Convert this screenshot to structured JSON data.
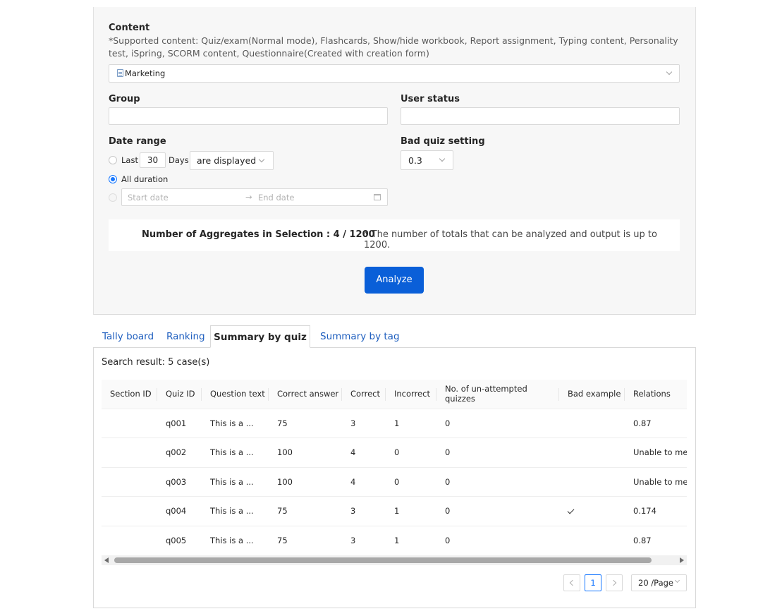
{
  "form": {
    "content_label": "Content",
    "content_note": "*Supported content: Quiz/exam(Normal mode), Flashcards, Show/hide workbook, Report assignment, Typing content, Personality test, iSpring, SCORM content, Questionnaire(Created with creation form)",
    "content_value": "Marketing",
    "group_label": "Group",
    "group_value": "",
    "user_status_label": "User status",
    "user_status_value": "",
    "date_range_label": "Date range",
    "last_label": "Last",
    "last_days": "30",
    "days_label": "Days",
    "display_select": "are displayed",
    "all_duration_label": "All duration",
    "selected_range_option": "all_duration",
    "start_placeholder": "Start date",
    "end_placeholder": "End date",
    "bad_quiz_label": "Bad quiz setting",
    "bad_quiz_value": "0.3"
  },
  "aggregates": {
    "label": "Number of Aggregates in Selection : 4 / 1200",
    "hint": "* The number of totals that can be analyzed and output is up to 1200."
  },
  "analyze_button": "Analyze",
  "tabs": [
    {
      "label": "Tally board",
      "active": false
    },
    {
      "label": "Ranking",
      "active": false
    },
    {
      "label": "Summary by quiz",
      "active": true
    },
    {
      "label": "Summary by tag",
      "active": false
    }
  ],
  "search_result": "Search result: 5 case(s)",
  "table": {
    "headers": [
      "Section ID",
      "Quiz ID",
      "Question text",
      "Correct answer",
      "Correct",
      "Incorrect",
      "No. of un-attempted quizzes",
      "Bad example",
      "Relations"
    ],
    "rows": [
      {
        "section_id": "",
        "quiz_id": "q001",
        "question": "This is a ...",
        "answer": "75",
        "correct": "3",
        "incorrect": "1",
        "unattempted": "0",
        "bad": false,
        "relations": "0.87"
      },
      {
        "section_id": "",
        "quiz_id": "q002",
        "question": "This is a ...",
        "answer": "100",
        "correct": "4",
        "incorrect": "0",
        "unattempted": "0",
        "bad": false,
        "relations": "Unable to measure"
      },
      {
        "section_id": "",
        "quiz_id": "q003",
        "question": "This is a ...",
        "answer": "100",
        "correct": "4",
        "incorrect": "0",
        "unattempted": "0",
        "bad": false,
        "relations": "Unable to measure"
      },
      {
        "section_id": "",
        "quiz_id": "q004",
        "question": "This is a ...",
        "answer": "75",
        "correct": "3",
        "incorrect": "1",
        "unattempted": "0",
        "bad": true,
        "relations": "0.174"
      },
      {
        "section_id": "",
        "quiz_id": "q005",
        "question": "This is a ...",
        "answer": "75",
        "correct": "3",
        "incorrect": "1",
        "unattempted": "0",
        "bad": false,
        "relations": "0.87"
      }
    ]
  },
  "pagination": {
    "current_page": "1",
    "page_size": "20 /Page"
  },
  "colors": {
    "accent": "#1677ff",
    "button": "#0a5fd8",
    "tab_link": "#1f5fbf"
  }
}
